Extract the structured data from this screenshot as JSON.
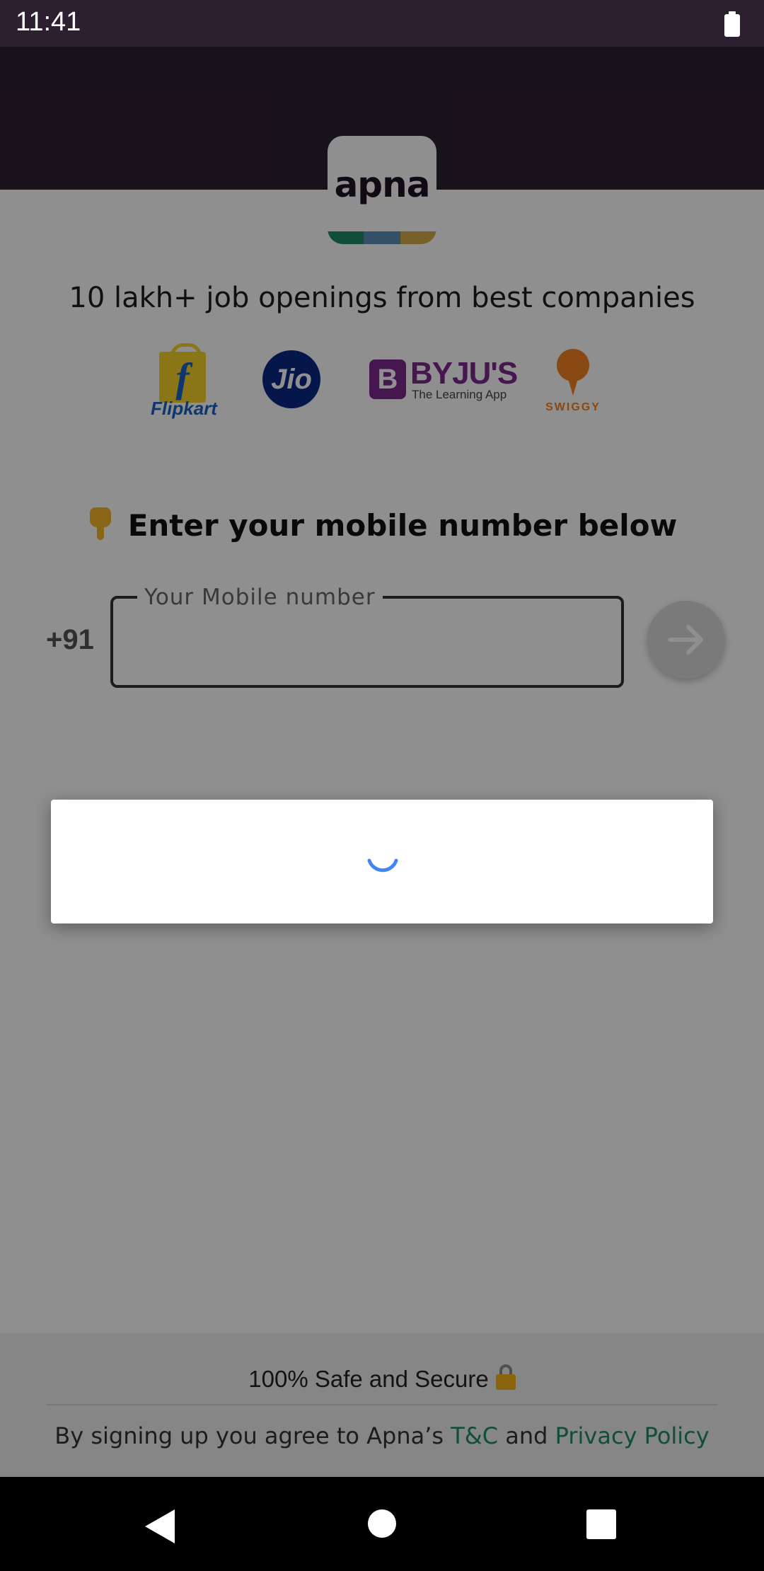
{
  "status_bar": {
    "time": "11:41"
  },
  "logo": {
    "text": "apna",
    "stripe_colors": [
      "#1e8a6a",
      "#5b8fb9",
      "#d4a94a"
    ]
  },
  "tagline": "10 lakh+ job openings from best companies",
  "brands": {
    "flipkart": {
      "letter": "f",
      "name": "Flipkart"
    },
    "jio": {
      "name": "Jio"
    },
    "byjus": {
      "letter": "B",
      "name": "BYJU'S",
      "tagline": "The Learning App"
    },
    "swiggy": {
      "name": "SWIGGY"
    }
  },
  "login": {
    "title": "Enter your mobile number below",
    "country_code": "+91",
    "phone_label": "Your Mobile number",
    "phone_value": ""
  },
  "footer": {
    "secure_text": "100% Safe and Secure",
    "terms_prefix": "By signing up you agree to Apna’s ",
    "terms_link": "T&C",
    "terms_and": " and ",
    "privacy_link": "Privacy Policy"
  },
  "loading_dialog": {
    "state": "loading"
  },
  "colors": {
    "header": "#2c2030",
    "accent_link": "#1e8a6a",
    "spinner": "#4285f4"
  }
}
